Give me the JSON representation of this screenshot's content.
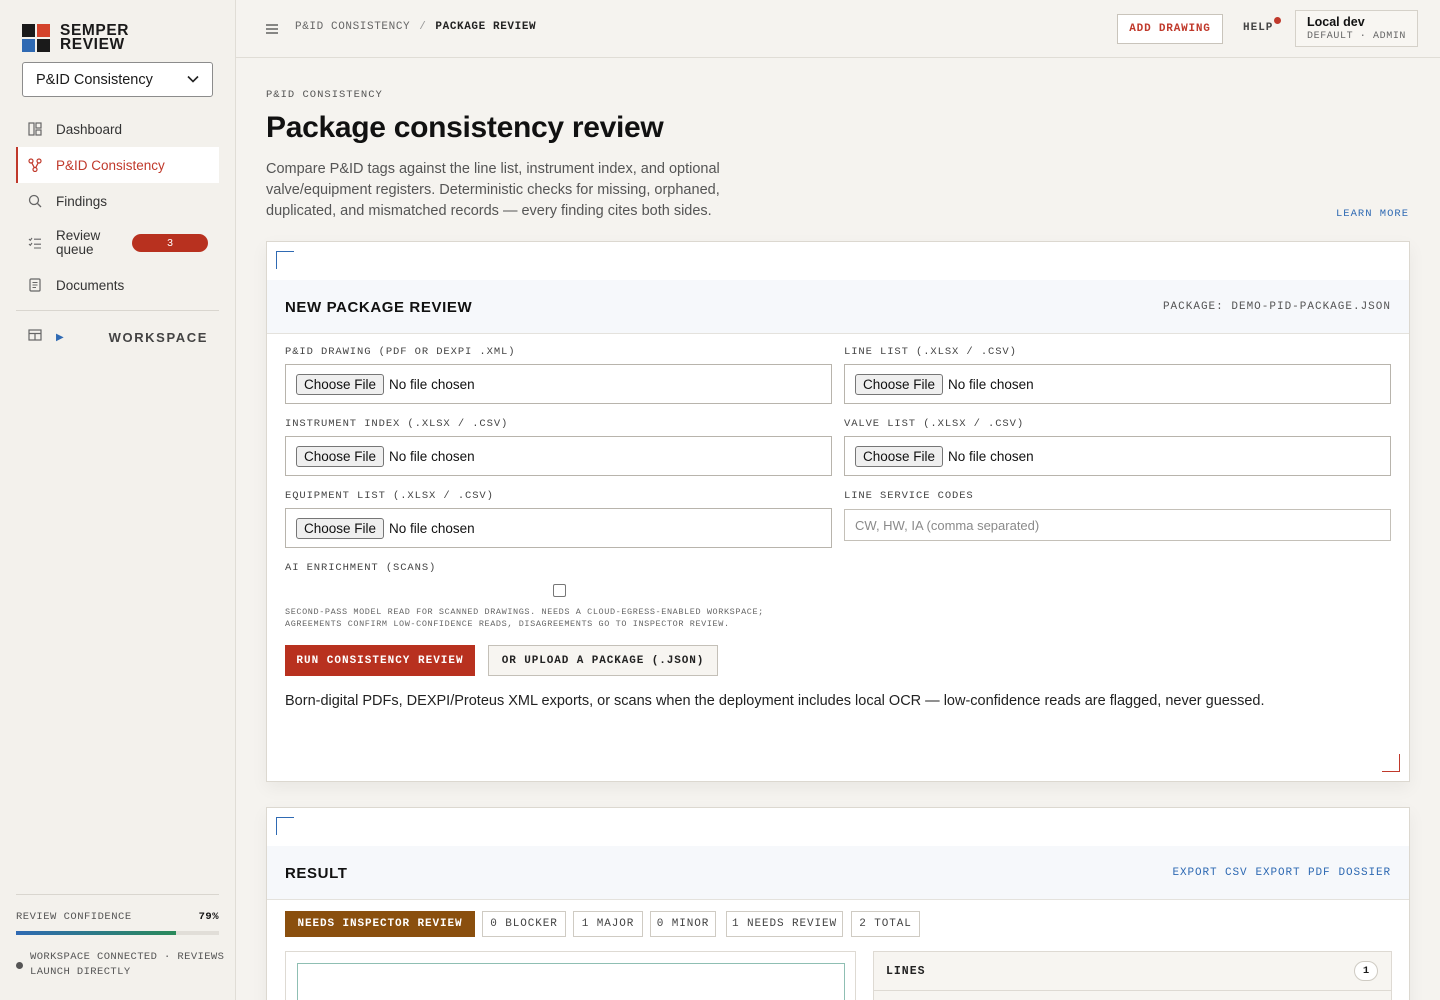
{
  "brand": {
    "name_line1": "SEMPER",
    "name_line2": "REVIEW"
  },
  "workspace_select": {
    "value": "P&ID Consistency"
  },
  "nav": [
    {
      "label": "Dashboard",
      "icon": "dashboard-icon"
    },
    {
      "label": "P&ID Consistency",
      "icon": "branch-icon",
      "active": true
    },
    {
      "label": "Findings",
      "icon": "search-icon"
    },
    {
      "label": "Review queue",
      "icon": "checklist-icon",
      "badge": "3"
    },
    {
      "label": "Documents",
      "icon": "document-icon"
    }
  ],
  "workspace_section": {
    "label": "WORKSPACE"
  },
  "footer": {
    "confidence_label": "REVIEW CONFIDENCE",
    "confidence_value": "79%",
    "confidence_fraction": 0.79,
    "status_text": "WORKSPACE CONNECTED · REVIEWS LAUNCH DIRECTLY"
  },
  "topbar": {
    "crumb_parent": "P&ID CONSISTENCY",
    "crumb_sep": "/",
    "crumb_current": "PACKAGE REVIEW",
    "add_drawing": "ADD DRAWING",
    "help": "HELP",
    "user_name": "Local dev",
    "user_role": "DEFAULT · ADMIN"
  },
  "page": {
    "eyebrow": "P&ID CONSISTENCY",
    "title": "Package consistency review",
    "description": "Compare P&ID tags against the line list, instrument index, and optional valve/equipment registers. Deterministic checks for missing, orphaned, duplicated, and mismatched records — every finding cites both sides.",
    "learn_more": "LEARN MORE"
  },
  "new_review": {
    "title": "NEW PACKAGE REVIEW",
    "package": "PACKAGE: DEMO-PID-PACKAGE.JSON",
    "file_button": "Choose File",
    "no_file": "No file chosen",
    "fields": {
      "pid": "P&ID DRAWING (PDF OR DEXPI .XML)",
      "line_list": "LINE LIST (.XLSX / .CSV)",
      "instrument": "INSTRUMENT INDEX (.XLSX / .CSV)",
      "valve": "VALVE LIST (.XLSX / .CSV)",
      "equipment": "EQUIPMENT LIST (.XLSX / .CSV)",
      "service_codes": "LINE SERVICE CODES"
    },
    "service_placeholder": "CW, HW, IA (comma separated)",
    "ai_label": "AI ENRICHMENT (SCANS)",
    "ai_note": "SECOND-PASS MODEL READ FOR SCANNED DRAWINGS. NEEDS A CLOUD-EGRESS-ENABLED WORKSPACE; AGREEMENTS CONFIRM LOW-CONFIDENCE READS, DISAGREEMENTS GO TO INSPECTOR REVIEW.",
    "run_button": "RUN CONSISTENCY REVIEW",
    "upload_button": "OR UPLOAD A PACKAGE (.JSON)",
    "footnote": "Born-digital PDFs, DEXPI/Proteus XML exports, or scans when the deployment includes local OCR — low-confidence reads are flagged, never guessed."
  },
  "result": {
    "title": "RESULT",
    "export_csv": "EXPORT CSV",
    "export_pdf": "EXPORT PDF",
    "dossier": "DOSSIER",
    "status": "NEEDS INSPECTOR REVIEW",
    "counts": [
      "0 BLOCKER",
      "1 MAJOR",
      "0 MINOR",
      "1 NEEDS REVIEW",
      "2 TOTAL"
    ],
    "lines_title": "LINES",
    "lines_count": "1"
  },
  "colors": {
    "accent_red": "#b8311f",
    "link_blue": "#2f6ab3",
    "status_brown": "#8a4f0e"
  }
}
